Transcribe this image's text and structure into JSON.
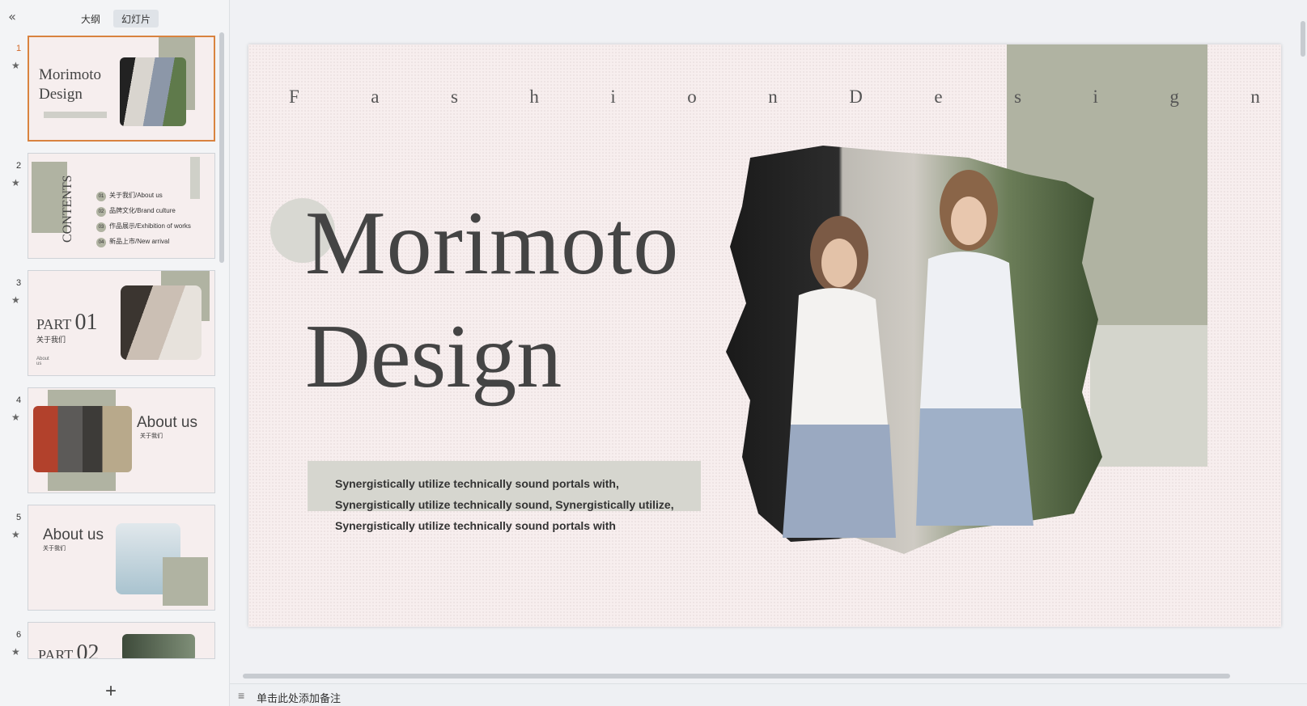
{
  "sidebar": {
    "collapse_icon": "«",
    "tabs": [
      {
        "label": "大纲",
        "active": false
      },
      {
        "label": "幻灯片",
        "active": true
      }
    ],
    "add_icon": "+",
    "thumbnails": [
      {
        "num": "1",
        "title1": "Morimoto",
        "title2": "Design"
      },
      {
        "num": "2",
        "contents": "CONTENTS",
        "items": [
          {
            "n": "01",
            "text": "关于我们/About us"
          },
          {
            "n": "02",
            "text": "品牌文化/Brand culture"
          },
          {
            "n": "03",
            "text": "作品展示/Exhibition of works"
          },
          {
            "n": "04",
            "text": "新品上市/New arrival"
          }
        ]
      },
      {
        "num": "3",
        "part": "PART",
        "part_num": "01",
        "sub": "关于我们",
        "tiny": "About us"
      },
      {
        "num": "4",
        "heading": "About us",
        "sub": "关于我们"
      },
      {
        "num": "5",
        "heading": "About us",
        "sub": "关于我们"
      },
      {
        "num": "6",
        "part": "PART",
        "part_num": "02"
      }
    ],
    "star_icon": "★"
  },
  "slide": {
    "fashion_letters": [
      "F",
      "a",
      "s",
      "h",
      "i",
      "o",
      "n",
      "D",
      "e",
      "s",
      "i",
      "g",
      "n"
    ],
    "title_line1": "Morimoto",
    "title_line2": "Design",
    "body": "Synergistically utilize technically sound portals with, Synergistically utilize technically sound, Synergistically utilize, Synergistically utilize technically sound portals with"
  },
  "notes": {
    "icon": "≡",
    "placeholder": "单击此处添加备注"
  },
  "colors": {
    "slide_bg": "#f7eeee",
    "olive": "#b0b3a2",
    "active_border": "#d9833f"
  }
}
